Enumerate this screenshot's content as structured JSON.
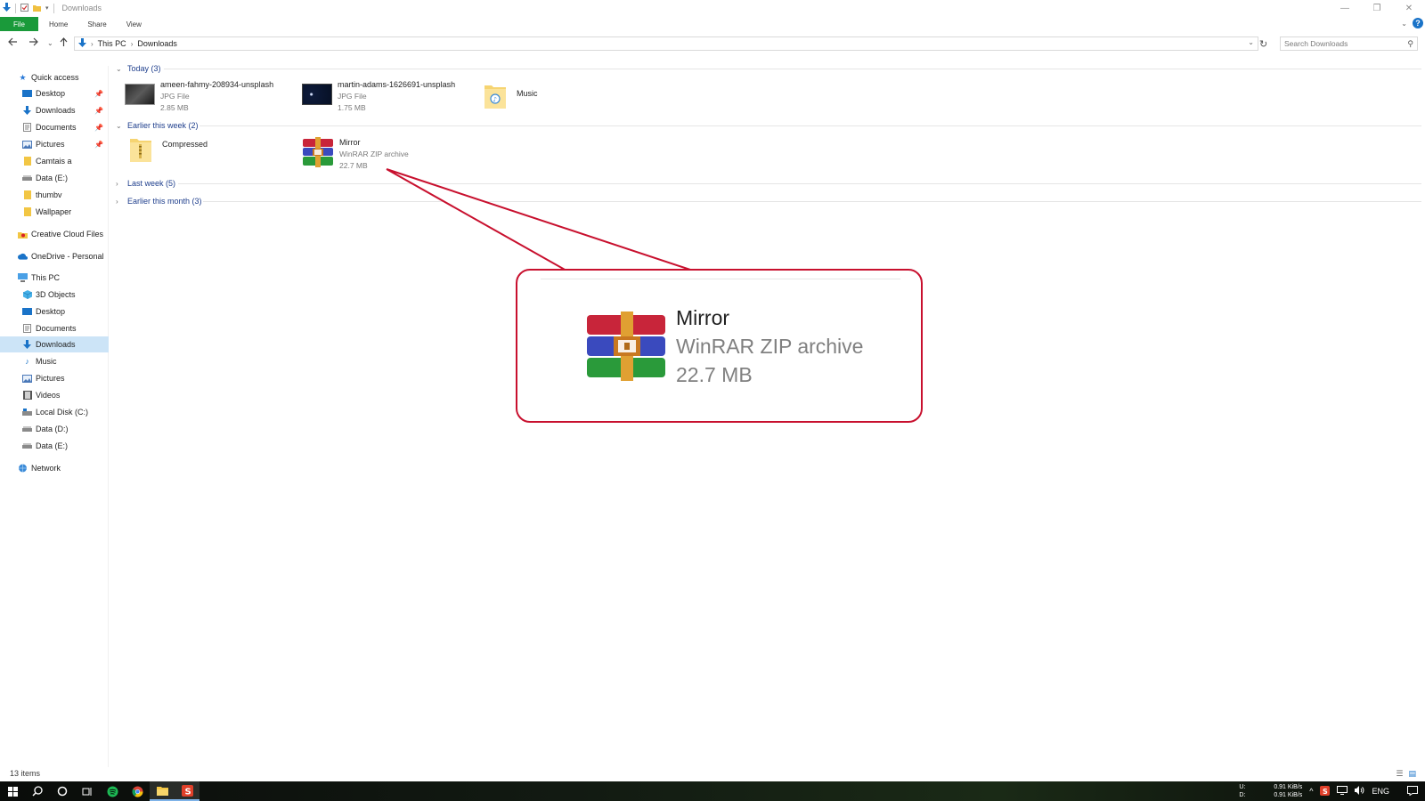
{
  "window": {
    "title": "Downloads",
    "controls": {
      "minimize": "—",
      "maximize": "❐",
      "close": "✕"
    }
  },
  "ribbon": {
    "tabs": [
      "File",
      "Home",
      "Share",
      "View"
    ],
    "help": "?"
  },
  "address": {
    "crumbs": [
      "This PC",
      "Downloads"
    ],
    "search_placeholder": "Search Downloads"
  },
  "nav": {
    "quick_access": "Quick access",
    "quick_items": [
      {
        "label": "Desktop",
        "icon": "desktop-icon",
        "pinned": true
      },
      {
        "label": "Downloads",
        "icon": "download-arrow-icon",
        "pinned": true
      },
      {
        "label": "Documents",
        "icon": "document-icon",
        "pinned": true
      },
      {
        "label": "Pictures",
        "icon": "picture-icon",
        "pinned": true
      },
      {
        "label": "Camtais a",
        "icon": "folder-icon",
        "pinned": false
      },
      {
        "label": "Data (E:)",
        "icon": "drive-icon",
        "pinned": false
      },
      {
        "label": "thumbv",
        "icon": "folder-icon",
        "pinned": false
      },
      {
        "label": "Wallpaper",
        "icon": "folder-icon",
        "pinned": false
      }
    ],
    "creative_cloud": "Creative Cloud Files",
    "onedrive": "OneDrive - Personal",
    "this_pc": "This PC",
    "pc_items": [
      {
        "label": "3D Objects",
        "icon": "cube-icon"
      },
      {
        "label": "Desktop",
        "icon": "desktop-icon"
      },
      {
        "label": "Documents",
        "icon": "document-icon"
      },
      {
        "label": "Downloads",
        "icon": "download-arrow-icon",
        "selected": true
      },
      {
        "label": "Music",
        "icon": "music-note-icon"
      },
      {
        "label": "Pictures",
        "icon": "picture-icon"
      },
      {
        "label": "Videos",
        "icon": "film-icon"
      },
      {
        "label": "Local Disk (C:)",
        "icon": "drive-icon"
      },
      {
        "label": "Data (D:)",
        "icon": "drive-icon"
      },
      {
        "label": "Data (E:)",
        "icon": "drive-icon"
      }
    ],
    "network": "Network"
  },
  "groups": {
    "today": "Today (3)",
    "earlier_week": "Earlier this week (2)",
    "last_week": "Last week (5)",
    "earlier_month": "Earlier this month (3)"
  },
  "files": {
    "today": [
      {
        "name": "ameen-fahmy-208934-unsplash",
        "type": "JPG File",
        "size": "2.85 MB"
      },
      {
        "name": "martin-adams-1626691-unsplash",
        "type": "JPG File",
        "size": "1.75 MB"
      },
      {
        "name": "Music"
      }
    ],
    "earlier_week": [
      {
        "name": "Compressed"
      },
      {
        "name": "Mirror",
        "type": "WinRAR ZIP archive",
        "size": "22.7 MB"
      }
    ]
  },
  "callout": {
    "name": "Mirror",
    "type": "WinRAR ZIP archive",
    "size": "22.7 MB",
    "border_color": "#c8102e"
  },
  "status": {
    "count": "13 items"
  },
  "taskbar": {
    "net_labels": [
      "U:",
      "D:"
    ],
    "net_values": [
      "0.91 KiB/s",
      "0.91 KiB/s"
    ],
    "lang": "ENG"
  },
  "colors": {
    "file_tab": "#1a9a3a",
    "group_header": "#1e3e8c",
    "selection": "#cce4f7"
  }
}
